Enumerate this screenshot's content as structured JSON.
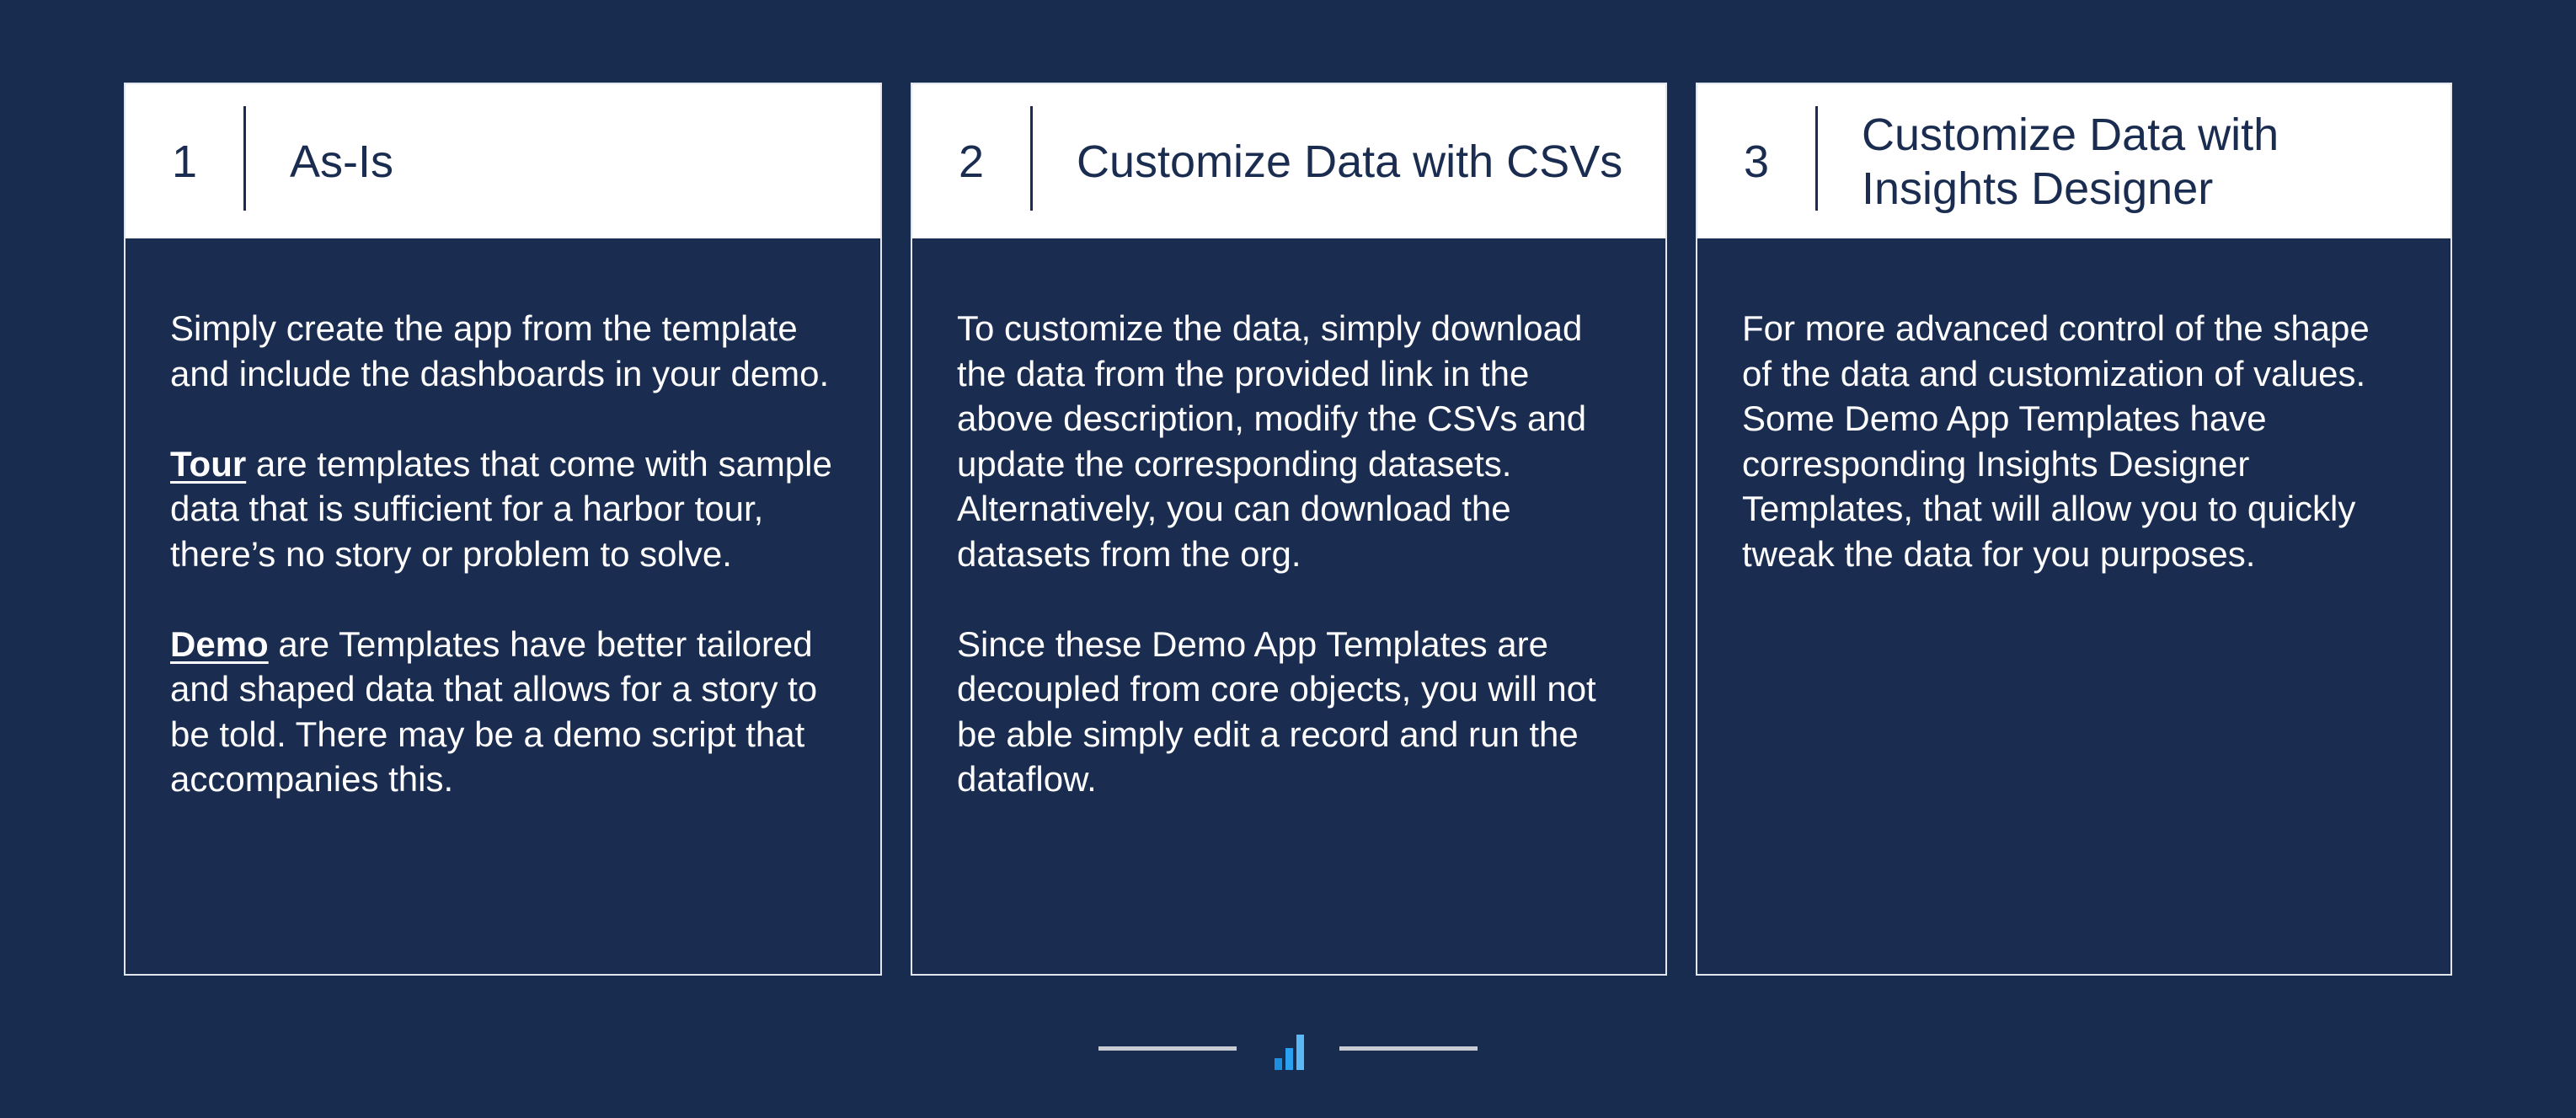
{
  "cards": [
    {
      "number": "1",
      "title": "As-Is",
      "paragraphs": [
        {
          "term": "",
          "text": "Simply create the app from the template and include the dashboards in your demo."
        },
        {
          "term": "Tour",
          "text": " are templates that come with sample data that is sufficient for a harbor tour, there’s no story or problem to solve."
        },
        {
          "term": "Demo",
          "text": " are Templates have better tailored and shaped data that allows for a story to be told. There may be a demo script that accompanies this."
        }
      ]
    },
    {
      "number": "2",
      "title": "Customize Data with CSVs",
      "paragraphs": [
        {
          "term": "",
          "text": "To customize the data, simply download the data from the provided link in the above description, modify the CSVs and update the corresponding datasets. Alternatively, you can download the datasets from the org."
        },
        {
          "term": "",
          "text": "Since these Demo App Templates are decoupled from core objects, you will not be able simply edit a record and run the dataflow."
        }
      ]
    },
    {
      "number": "3",
      "title": "Customize Data with Insights Designer",
      "paragraphs": [
        {
          "term": "",
          "text": "For more advanced control of the shape of the data and customization of values. Some Demo App Templates have corresponding Insights Designer Templates, that will allow you to quickly tweak the data for you purposes."
        }
      ]
    }
  ],
  "footer": {
    "logo_icon": "bar-chart-logo-icon",
    "line_color": "#c9ccd3",
    "logo_colors": [
      "#1c8fe0",
      "#2aa0f0",
      "#5ab8f5"
    ]
  },
  "colors": {
    "background": "#172c4f",
    "card_header": "#ffffff",
    "text_dark": "#1a2d51",
    "text_light": "#ffffff"
  }
}
